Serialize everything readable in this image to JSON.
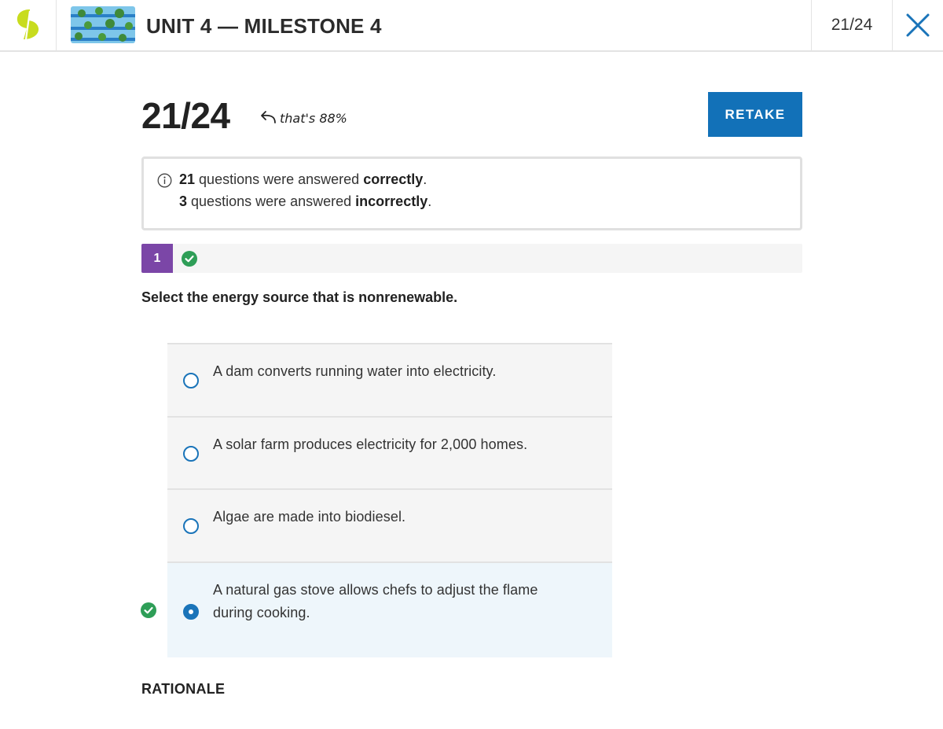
{
  "header": {
    "title": "UNIT 4 — MILESTONE 4",
    "score": "21/24",
    "logo_icon": "sophia-logo-icon",
    "thumbnail_icon": "unit-thumbnail-image",
    "close_icon": "close-icon"
  },
  "result": {
    "score": "21/24",
    "annotation": "that's 88%",
    "retake_label": "RETAKE"
  },
  "summary": {
    "correct_count": "21",
    "correct_text": "questions were answered",
    "correct_word": "correctly",
    "incorrect_count": "3",
    "incorrect_text": "questions were answered",
    "incorrect_word": "incorrectly",
    "period": "."
  },
  "question_nav": {
    "number": "1",
    "status": "correct"
  },
  "question": {
    "prompt": "Select the energy source that is nonrenewable.",
    "options": [
      {
        "text": "A dam converts running water into electricity.",
        "selected": false
      },
      {
        "text": "A solar farm produces electricity for 2,000 homes.",
        "selected": false
      },
      {
        "text": "Algae are made into biodiesel.",
        "selected": false
      },
      {
        "text": "A natural gas stove allows chefs to adjust the flame during cooking.",
        "selected": true,
        "correct": true
      }
    ]
  },
  "rationale_label": "RATIONALE",
  "colors": {
    "accent_blue": "#1271b8",
    "question_purple": "#7b46a7",
    "correct_green": "#2e9e57",
    "logo_yellow": "#c8dc1e"
  }
}
